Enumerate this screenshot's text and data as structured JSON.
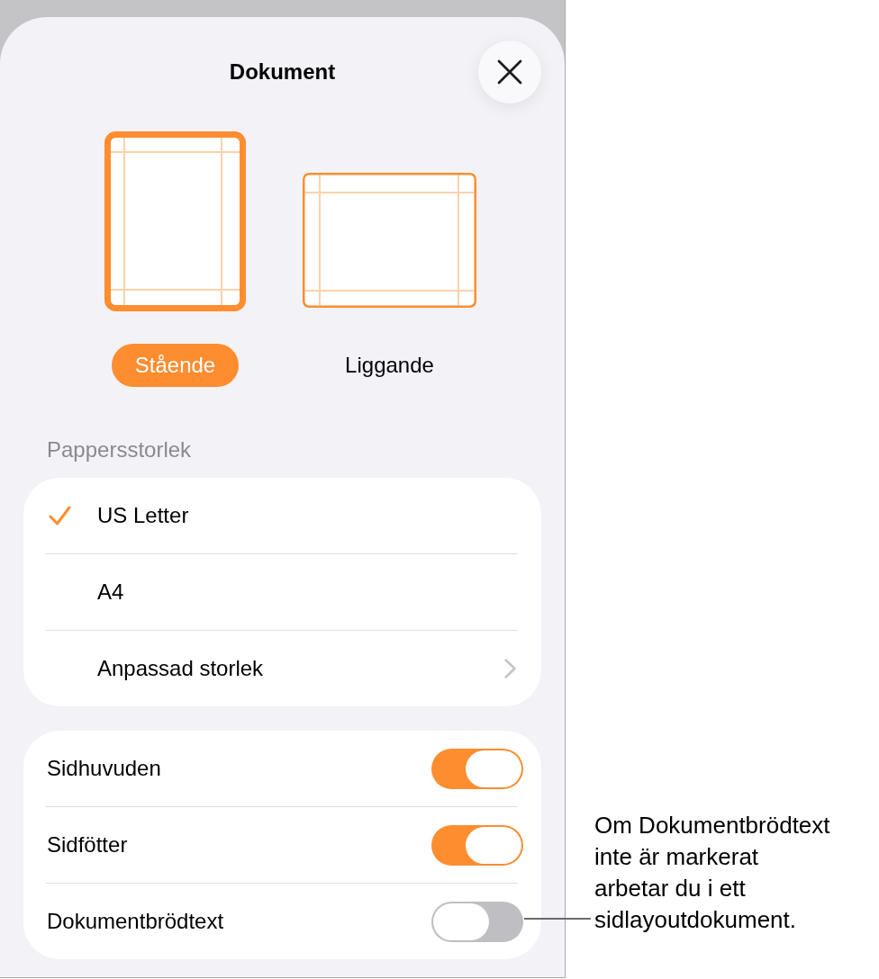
{
  "sheet": {
    "title": "Dokument"
  },
  "orientations": [
    {
      "kind": "portrait",
      "label": "Stående",
      "selected": true
    },
    {
      "kind": "landscape",
      "label": "Liggande",
      "selected": false
    }
  ],
  "paper_size": {
    "heading": "Pappersstorlek",
    "options": [
      {
        "kind": "choice",
        "label": "US Letter",
        "selected": true
      },
      {
        "kind": "choice",
        "label": "A4",
        "selected": false
      },
      {
        "kind": "submenu",
        "label": "Anpassad storlek",
        "selected": false
      }
    ]
  },
  "switches": [
    {
      "label": "Sidhuvuden",
      "on": true
    },
    {
      "label": "Sidfötter",
      "on": true
    },
    {
      "label": "Dokumentbrödtext",
      "on": false
    }
  ],
  "callout": {
    "text": "Om Dokumentbrödtext\ninte är markerat\narbetar du i ett\nsidlayoutdokument."
  }
}
